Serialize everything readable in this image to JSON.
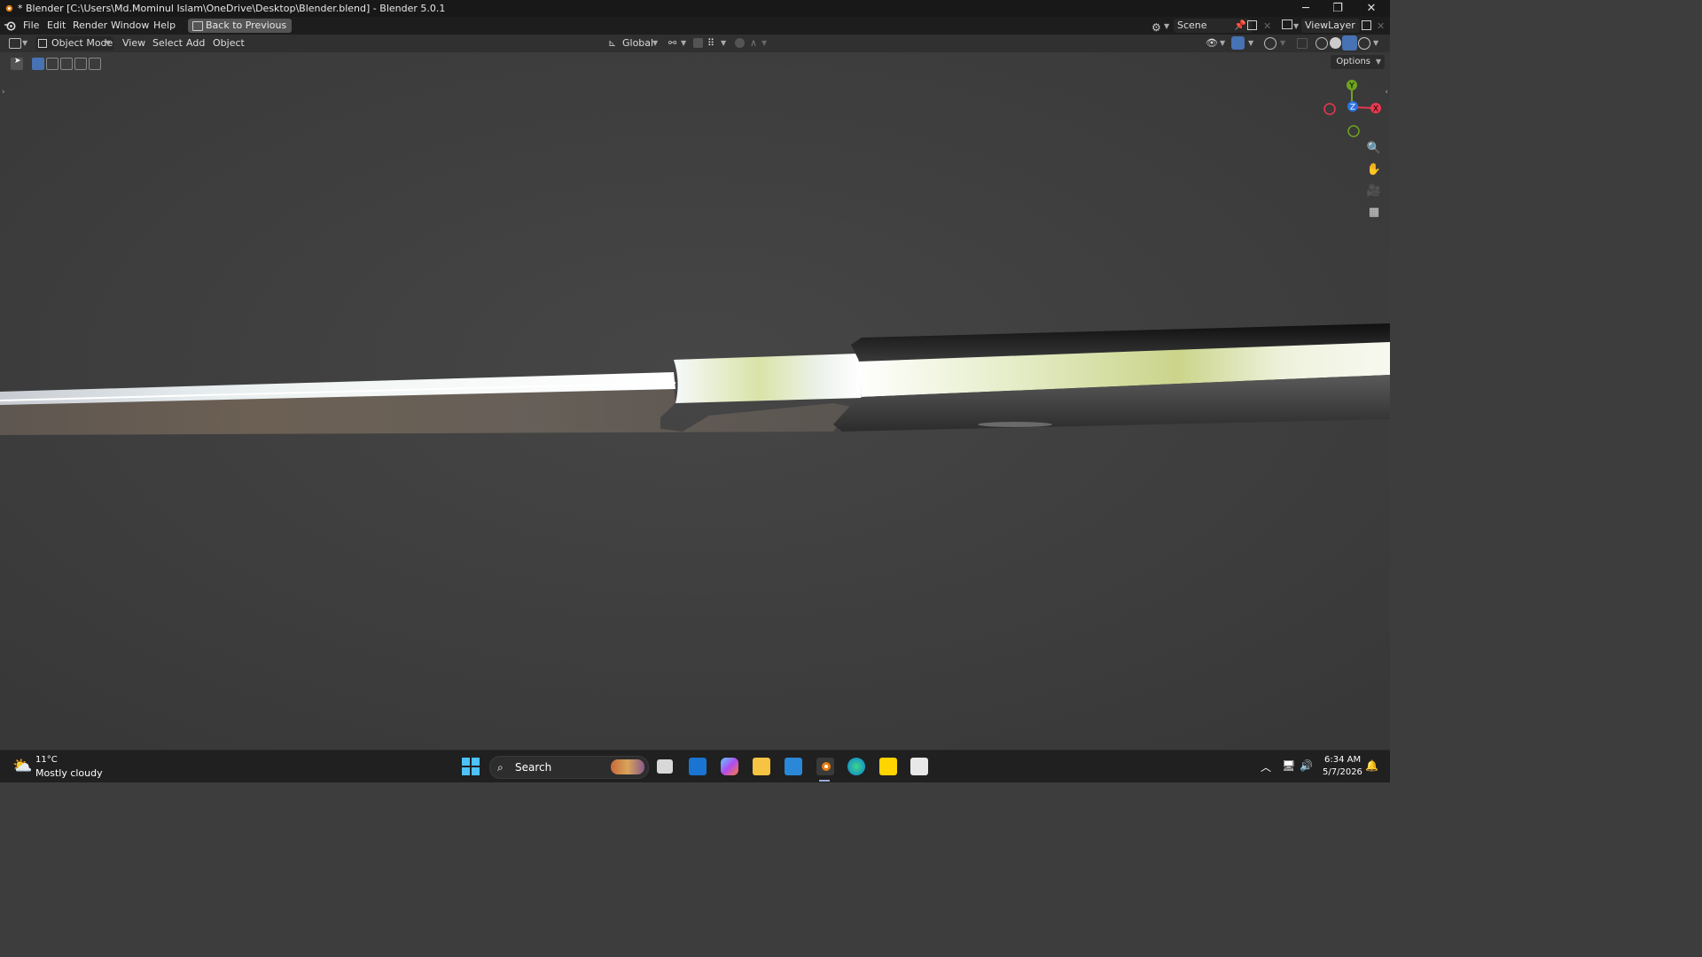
{
  "window": {
    "title": "* Blender [C:\\Users\\Md.Mominul Islam\\OneDrive\\Desktop\\Blender.blend] - Blender 5.0.1",
    "minimize": "─",
    "maximize": "❐",
    "close": "✕"
  },
  "menu": {
    "items": [
      "File",
      "Edit",
      "Render",
      "Window",
      "Help"
    ],
    "back_button": "Back to Previous",
    "scene": "Scene",
    "view_layer": "ViewLayer"
  },
  "viewport_header": {
    "mode": "Object Mode",
    "menus": [
      "View",
      "Select",
      "Add",
      "Object"
    ],
    "orientation": "Global"
  },
  "viewport": {
    "options": "Options",
    "gizmo": {
      "y": "Y",
      "z": "Z",
      "x": "X"
    }
  },
  "taskbar": {
    "weather_temp": "11°C",
    "weather_desc": "Mostly cloudy",
    "search_placeholder": "Search",
    "time": "6:34 AM",
    "date": "5/7/2026"
  },
  "colors": {
    "gizmo_x": "#e8384f",
    "gizmo_y": "#6ea41e",
    "gizmo_z": "#2b73e0",
    "accent": "#4772b3"
  }
}
